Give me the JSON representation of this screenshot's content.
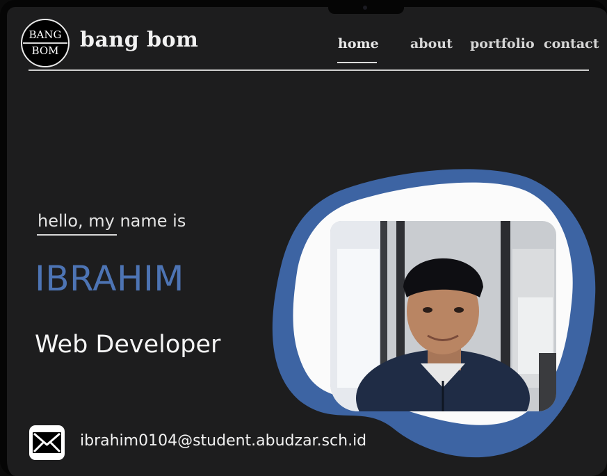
{
  "brand": {
    "badge_line1": "BANG",
    "badge_line2": "BOM",
    "name": "bang bom"
  },
  "nav": {
    "items": [
      {
        "label": "home",
        "active": true
      },
      {
        "label": "about",
        "active": false
      },
      {
        "label": "portfolio",
        "active": false
      },
      {
        "label": "contact",
        "active": false
      }
    ]
  },
  "hero": {
    "greeting": "hello, my name is",
    "name": "IBRAHIM",
    "role": "Web Developer"
  },
  "contact": {
    "email": "ibrahim0104@student.abudzar.sch.id",
    "icon": "envelope-icon"
  },
  "colors": {
    "background": "#1d1d1e",
    "accent": "#4d74b4",
    "blob": "#3d64a3",
    "text": "#f2f2f2"
  }
}
